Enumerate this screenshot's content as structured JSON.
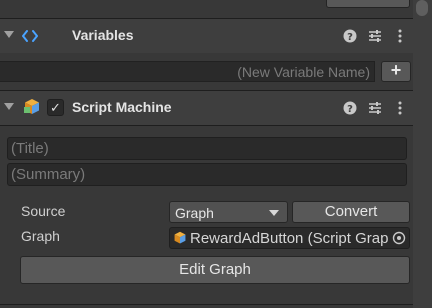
{
  "variables_component": {
    "title": "Variables",
    "new_variable_placeholder": "(New Variable Name)",
    "add_label": "+"
  },
  "script_machine_component": {
    "title": "Script Machine",
    "enabled_check": "✓",
    "title_placeholder": "(Title)",
    "summary_placeholder": "(Summary)",
    "source_label": "Source",
    "source_value": "Graph",
    "convert_label": "Convert",
    "graph_label": "Graph",
    "graph_value": "RewardAdButton (Script Graph Asset)",
    "edit_graph_label": "Edit Graph"
  },
  "colors": {
    "background": "#383838",
    "header": "#3e3e3e",
    "field": "#2a2a2a",
    "button": "#585858",
    "variables_icon": "#4aa3ff",
    "script_icon_orange": "#f0a030",
    "script_icon_blue": "#5a9ee6"
  },
  "icons": {
    "variables": "code-brackets-icon",
    "script_machine": "script-graph-icon",
    "help": "help-icon",
    "presets": "sliders-icon",
    "menu": "kebab-menu-icon",
    "object_picker": "target-picker-icon"
  }
}
